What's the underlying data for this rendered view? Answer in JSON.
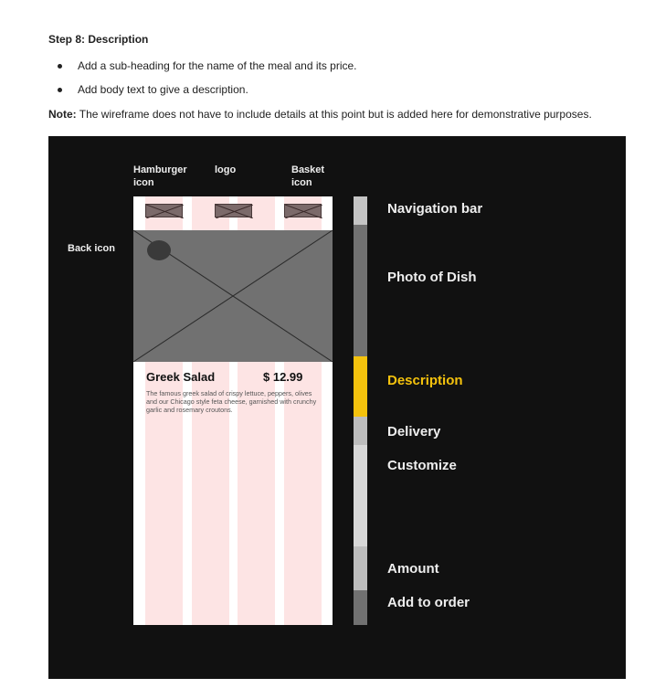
{
  "step_title": "Step 8: Description",
  "bullets": [
    "Add a sub-heading for the name of the meal and its price.",
    "Add body text to give a description."
  ],
  "note": {
    "label": "Note:",
    "text": "The wireframe does not have to include details at this point but is added here for demonstrative purposes."
  },
  "annotations": {
    "hamburger": "Hamburger icon",
    "logo": "logo",
    "basket": "Basket icon",
    "back": "Back icon"
  },
  "dish": {
    "name": "Greek Salad",
    "price": "$ 12.99",
    "description": "The famous greek salad of crispy lettuce, peppers, olives and our Chicago style feta cheese, garnished with crunchy garlic and rosemary croutons."
  },
  "sections": {
    "navigation": "Navigation bar",
    "photo": "Photo of Dish",
    "description": "Description",
    "delivery": "Delivery",
    "customize": "Customize",
    "amount": "Amount",
    "add_to_order": "Add to order"
  },
  "colors": {
    "active_section": "#f4c20d",
    "background": "#111111",
    "grid_column": "#fde4e4"
  }
}
